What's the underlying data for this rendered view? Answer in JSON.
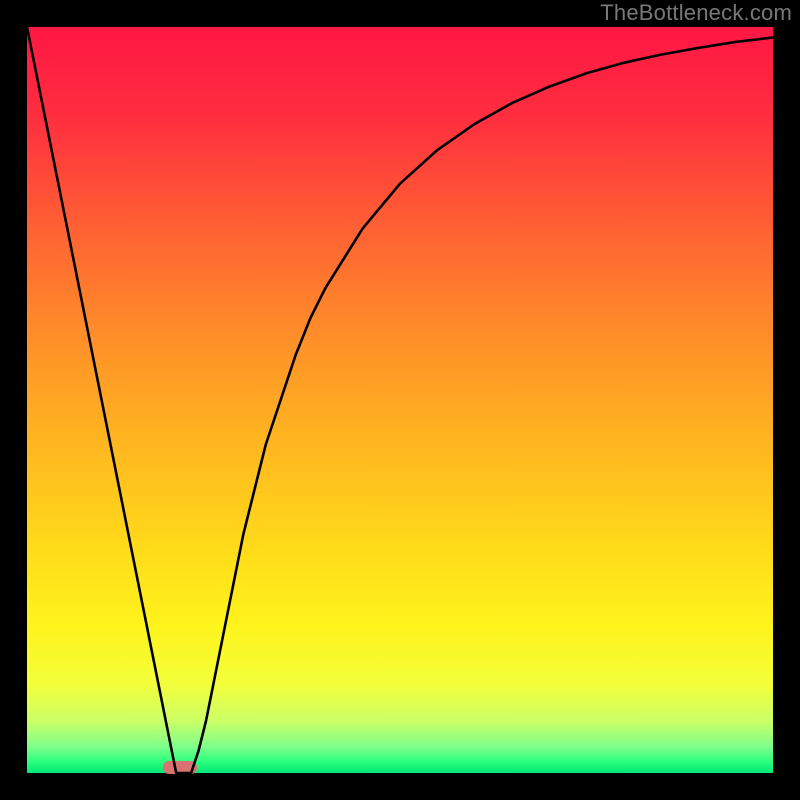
{
  "watermark": "TheBottleneck.com",
  "chart_data": {
    "type": "line",
    "title": "",
    "xlabel": "",
    "ylabel": "",
    "xlim": [
      0,
      100
    ],
    "ylim": [
      0,
      100
    ],
    "x": [
      0,
      2,
      4,
      6,
      8,
      10,
      12,
      14,
      16,
      17,
      18,
      19,
      20,
      21,
      22,
      23,
      24,
      25,
      26,
      27,
      28,
      29,
      30,
      32,
      34,
      36,
      38,
      40,
      45,
      50,
      55,
      60,
      65,
      70,
      75,
      80,
      85,
      90,
      95,
      100
    ],
    "y": [
      100,
      90,
      80,
      70,
      60,
      50,
      40,
      30,
      20,
      15,
      10,
      5,
      0,
      0,
      0,
      3,
      7,
      12,
      17,
      22,
      27,
      32,
      36,
      44,
      50,
      56,
      61,
      65,
      73,
      79,
      83.5,
      87,
      89.8,
      92,
      93.8,
      95.2,
      96.3,
      97.2,
      98,
      98.6
    ],
    "annotations": {
      "marker_at_bottom": {
        "x_center": 20.5,
        "x_half_width": 2.3,
        "color": "#db7170"
      }
    },
    "colors": {
      "curve": "#000000",
      "border": "#000000",
      "gradient_stops": [
        {
          "offset": 0.0,
          "color": "#ff1744"
        },
        {
          "offset": 0.12,
          "color": "#ff2e3f"
        },
        {
          "offset": 0.25,
          "color": "#ff5a35"
        },
        {
          "offset": 0.4,
          "color": "#ff8a2a"
        },
        {
          "offset": 0.55,
          "color": "#ffb420"
        },
        {
          "offset": 0.7,
          "color": "#ffdb1a"
        },
        {
          "offset": 0.8,
          "color": "#fff31c"
        },
        {
          "offset": 0.88,
          "color": "#f3ff3a"
        },
        {
          "offset": 0.93,
          "color": "#ccff66"
        },
        {
          "offset": 0.965,
          "color": "#7dff8a"
        },
        {
          "offset": 0.985,
          "color": "#2cff7d"
        },
        {
          "offset": 1.0,
          "color": "#00e676"
        }
      ]
    },
    "layout": {
      "outer_size": 800,
      "inner_margin": 27
    }
  }
}
